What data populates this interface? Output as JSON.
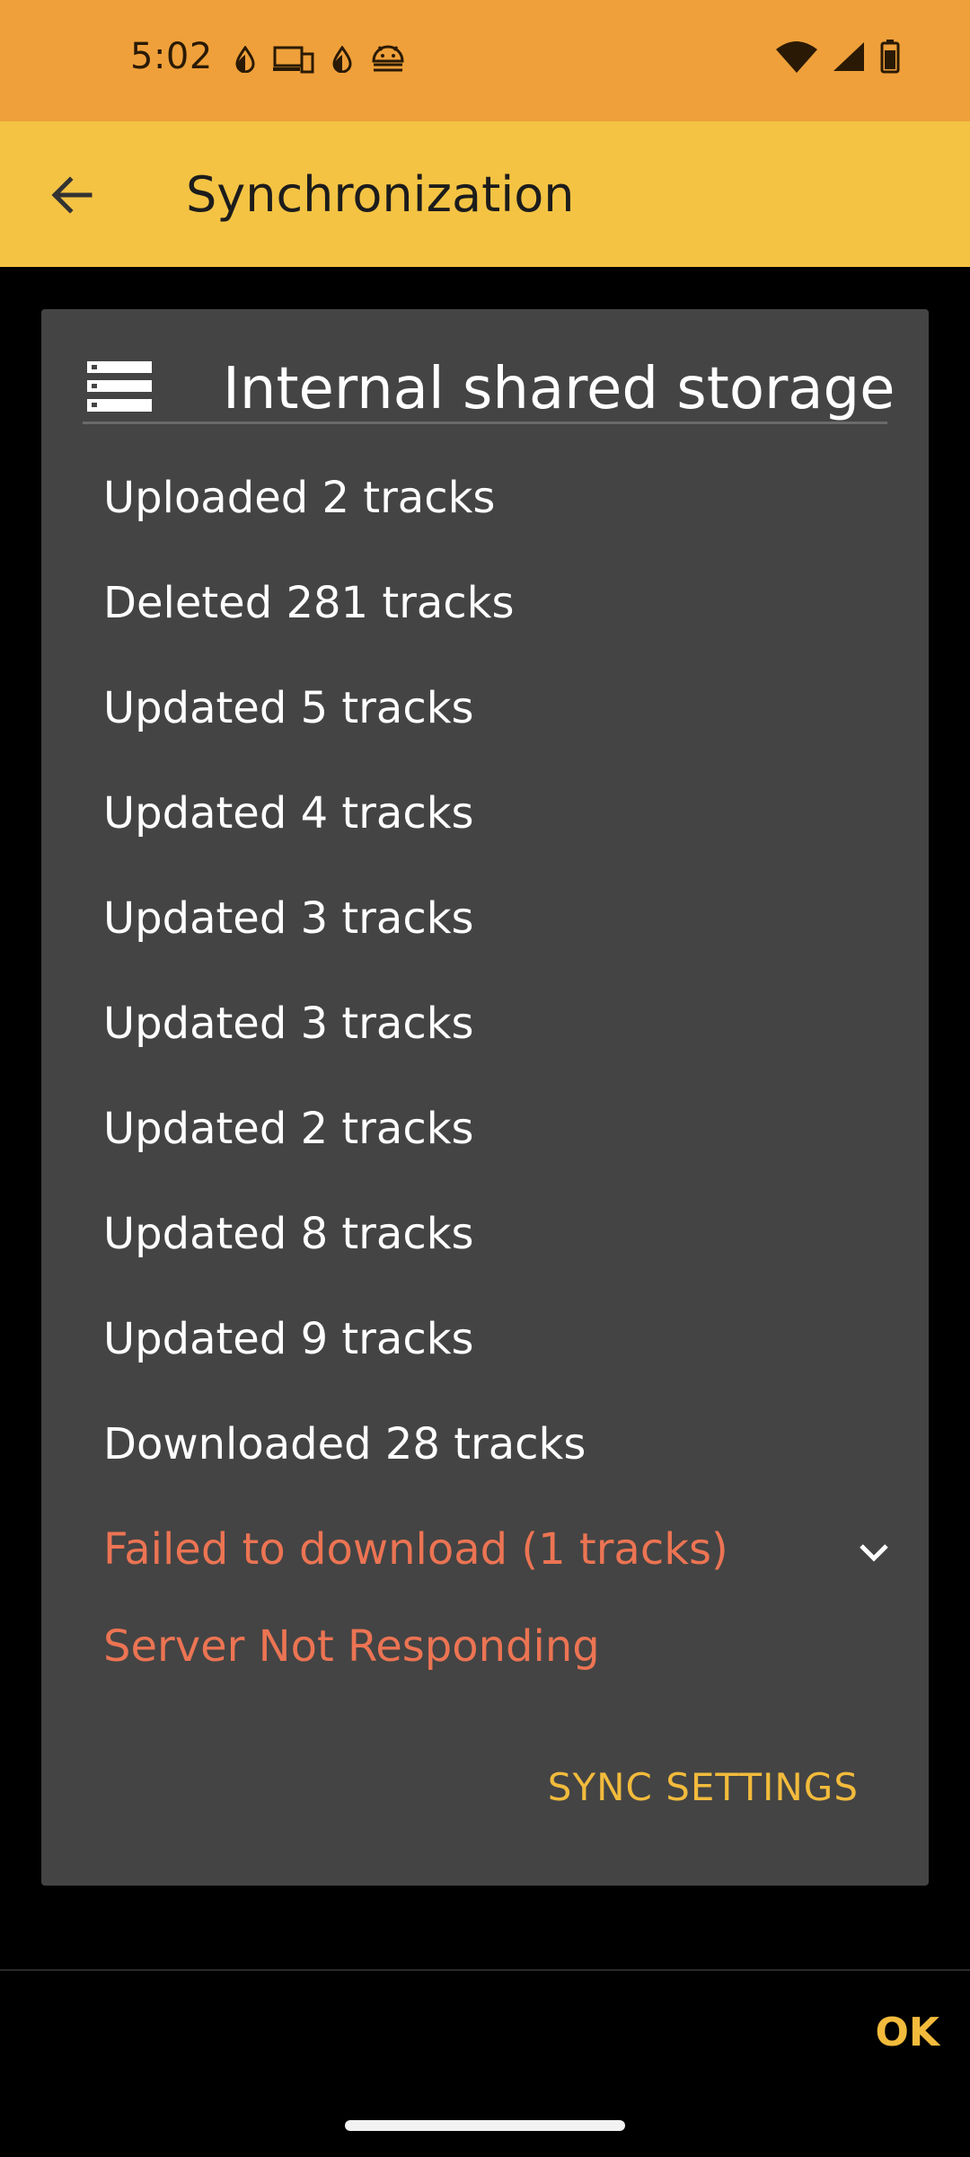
{
  "status_bar": {
    "time": "5:02",
    "left_icons": [
      "drop-icon",
      "devices-icon",
      "drop-icon",
      "android-icon"
    ],
    "right_icons": [
      "wifi-icon",
      "signal-icon",
      "battery-icon"
    ]
  },
  "app_bar": {
    "title": "Synchronization",
    "back_icon": "arrow-back-icon"
  },
  "dialog": {
    "storage_title": "Internal shared storage",
    "storage_icon": "storage-icon",
    "results": [
      "Uploaded 2 tracks",
      "Deleted 281 tracks",
      "Updated 5 tracks",
      "Updated 4 tracks",
      "Updated 3 tracks",
      "Updated 3 tracks",
      "Updated 2 tracks",
      "Updated 8 tracks",
      "Updated 9 tracks",
      "Downloaded 28 tracks"
    ],
    "failed_label": "Failed to download (1 tracks)",
    "server_message": "Server Not Responding",
    "sync_settings_label": "SYNC SETTINGS"
  },
  "footer": {
    "ok_label": "OK"
  },
  "colors": {
    "status_bar": "#efa03a",
    "app_bar": "#f4c343",
    "dialog_bg": "#444444",
    "error": "#ec7453",
    "accent": "#f2bb3c"
  }
}
